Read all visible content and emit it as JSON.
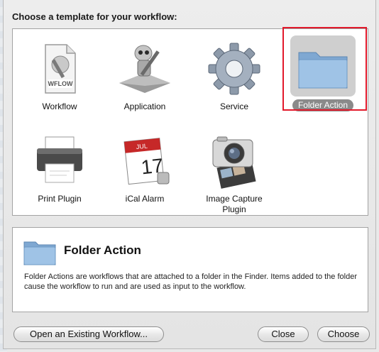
{
  "dialog": {
    "prompt": "Choose a template for your workflow:"
  },
  "templates": [
    {
      "label": "Workflow",
      "icon": "workflow-document-icon",
      "badge": "WFLOW"
    },
    {
      "label": "Application",
      "icon": "automator-robot-icon"
    },
    {
      "label": "Service",
      "icon": "gear-icon"
    },
    {
      "label": "Folder Action",
      "icon": "folder-icon",
      "selected": true
    },
    {
      "label": "Print Plugin",
      "icon": "printer-icon"
    },
    {
      "label": "iCal Alarm",
      "icon": "calendar-icon",
      "month": "JUL",
      "day": "17"
    },
    {
      "label": "Image Capture Plugin",
      "icon": "camera-icon"
    }
  ],
  "description": {
    "title": "Folder Action",
    "icon": "folder-icon",
    "text": "Folder Actions are workflows that are attached to a folder in the Finder. Items added to the folder cause the workflow to run and are used as input to the workflow."
  },
  "buttons": {
    "open_existing": "Open an Existing Workflow...",
    "close": "Close",
    "choose": "Choose"
  },
  "colors": {
    "selection_outline": "#e2192b",
    "selected_label_bg": "#8a8a8a",
    "folder_blue": "#8fb6dc"
  }
}
